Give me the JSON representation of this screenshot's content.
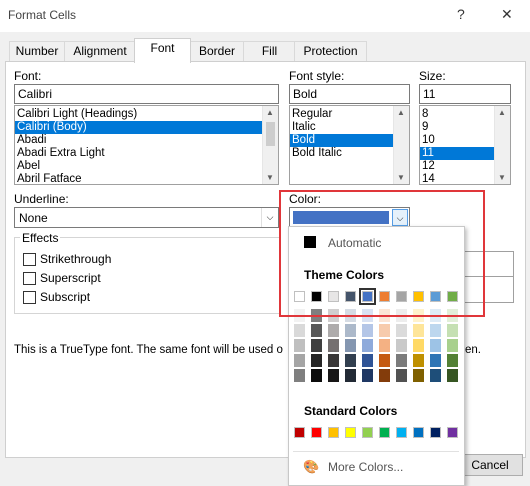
{
  "window": {
    "title": "Format Cells",
    "help": "?",
    "close": "✕"
  },
  "tabs": [
    "Number",
    "Alignment",
    "Font",
    "Border",
    "Fill",
    "Protection"
  ],
  "font": {
    "label": "Font:",
    "value": "Calibri",
    "items": [
      "Calibri Light (Headings)",
      "Calibri (Body)",
      "Abadi",
      "Abadi Extra Light",
      "Abel",
      "Abril Fatface"
    ],
    "selected_index": 1
  },
  "font_style": {
    "label": "Font style:",
    "value": "Bold",
    "items": [
      "Regular",
      "Italic",
      "Bold",
      "Bold Italic"
    ],
    "selected_index": 2
  },
  "size": {
    "label": "Size:",
    "value": "11",
    "items": [
      "8",
      "9",
      "10",
      "11",
      "12",
      "14"
    ],
    "selected_index": 3
  },
  "underline": {
    "label": "Underline:",
    "value": "None"
  },
  "color": {
    "label": "Color:",
    "value_color": "#4472c4"
  },
  "effects": {
    "title": "Effects",
    "items": [
      "Strikethrough",
      "Superscript",
      "Subscript"
    ]
  },
  "info_text": "This is a TrueType font.  The same font will be used o",
  "info_text_tail": "en.",
  "color_popup": {
    "automatic": "Automatic",
    "theme_title": "Theme Colors",
    "standard_title": "Standard Colors",
    "more": "More Colors...",
    "theme_colors": [
      "#ffffff",
      "#000000",
      "#e7e6e6",
      "#44546a",
      "#4472c4",
      "#ed7d31",
      "#a5a5a5",
      "#ffc000",
      "#5b9bd5",
      "#70ad47"
    ],
    "theme_shades": [
      [
        "#f2f2f2",
        "#7f7f7f",
        "#d0cece",
        "#d6dce4",
        "#d9e2f3",
        "#fbe5d5",
        "#ededed",
        "#fff2cc",
        "#deebf6",
        "#e2efd9"
      ],
      [
        "#d9d9d9",
        "#595959",
        "#aeabab",
        "#acb9ca",
        "#b4c6e7",
        "#f7cbac",
        "#dbdbdb",
        "#fee599",
        "#bdd7ee",
        "#c5e0b3"
      ],
      [
        "#bfbfbf",
        "#3f3f3f",
        "#757070",
        "#8496b0",
        "#8eaadb",
        "#f4b183",
        "#c9c9c9",
        "#ffd965",
        "#9dc3e6",
        "#a8d08d"
      ],
      [
        "#a5a5a5",
        "#262626",
        "#3a3838",
        "#323f4f",
        "#2f5496",
        "#c55a11",
        "#7b7b7b",
        "#bf9000",
        "#2e75b5",
        "#538135"
      ],
      [
        "#7f7f7f",
        "#0c0c0c",
        "#171616",
        "#222a35",
        "#1f3864",
        "#833c0b",
        "#525252",
        "#7f6000",
        "#1e4e79",
        "#375623"
      ]
    ],
    "standard_colors": [
      "#c00000",
      "#ff0000",
      "#ffc000",
      "#ffff00",
      "#92d050",
      "#00b050",
      "#00b0f0",
      "#0070c0",
      "#002060",
      "#7030a0"
    ]
  },
  "buttons": {
    "cancel": "Cancel"
  }
}
